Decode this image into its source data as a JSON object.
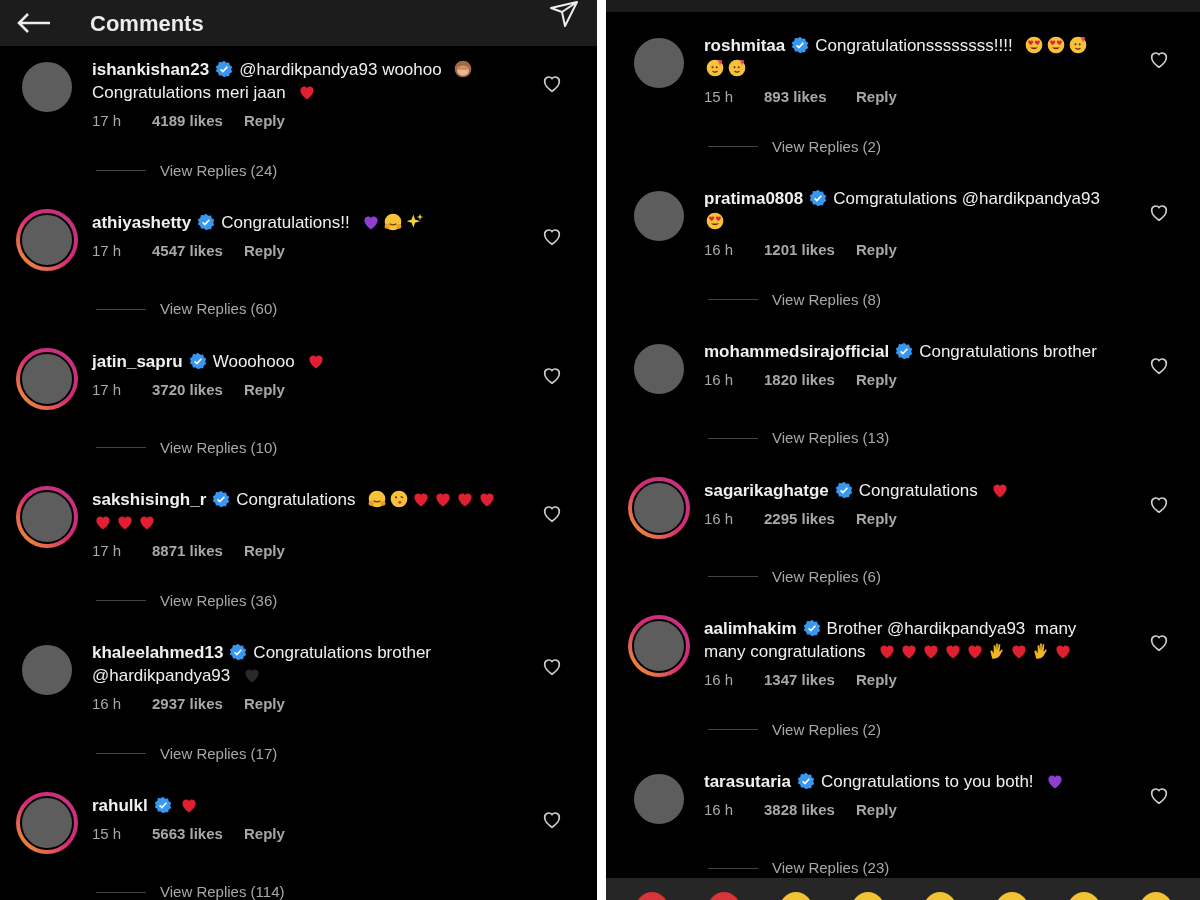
{
  "panels": [
    {
      "header": {
        "title": "Comments"
      },
      "comments": [
        {
          "user": "ishankishan23",
          "verified": true,
          "story_ring": false,
          "body": [
            {
              "kind": "text",
              "text": "@hardikpandya93 woohoo"
            },
            {
              "kind": "monkey"
            },
            {
              "kind": "text",
              "text": "Congratulations meri jaan"
            },
            {
              "kind": "heart",
              "color": "#e02030"
            }
          ],
          "time": "17 h",
          "likes": "4189 likes",
          "reply": "Reply",
          "view_replies": "View Replies (24)"
        },
        {
          "user": "athiyashetty",
          "verified": true,
          "story_ring": true,
          "body": [
            {
              "kind": "text",
              "text": "Congratulations!!"
            },
            {
              "kind": "heart",
              "color": "#8e3fd0"
            },
            {
              "kind": "hug"
            },
            {
              "kind": "sparkles"
            }
          ],
          "time": "17 h",
          "likes": "4547 likes",
          "reply": "Reply",
          "view_replies": "View Replies (60)"
        },
        {
          "user": "jatin_sapru",
          "verified": true,
          "story_ring": true,
          "body": [
            {
              "kind": "text",
              "text": "Wooohooo"
            },
            {
              "kind": "heart",
              "color": "#e02030"
            }
          ],
          "time": "17 h",
          "likes": "3720 likes",
          "reply": "Reply",
          "view_replies": "View Replies (10)"
        },
        {
          "user": "sakshisingh_r",
          "verified": true,
          "story_ring": true,
          "body": [
            {
              "kind": "text",
              "text": "Congratulations"
            },
            {
              "kind": "hug"
            },
            {
              "kind": "kiss"
            },
            {
              "kind": "heart",
              "color": "#e02030"
            },
            {
              "kind": "heart",
              "color": "#e02030"
            },
            {
              "kind": "heart",
              "color": "#e02030"
            },
            {
              "kind": "heart",
              "color": "#e02030"
            },
            {
              "kind": "heart",
              "color": "#e02030"
            },
            {
              "kind": "heart",
              "color": "#e02030"
            },
            {
              "kind": "heart",
              "color": "#e02030"
            }
          ],
          "time": "17 h",
          "likes": "8871 likes",
          "reply": "Reply",
          "view_replies": "View Replies (36)"
        },
        {
          "user": "khaleelahmed13",
          "verified": true,
          "story_ring": false,
          "body": [
            {
              "kind": "text",
              "text": "Congratulations brother"
            },
            {
              "kind": "text",
              "text": "@hardikpandya93"
            },
            {
              "kind": "heart",
              "color": "#2a2a2a"
            }
          ],
          "time": "16 h",
          "likes": "2937 likes",
          "reply": "Reply",
          "view_replies": "View Replies (17)"
        },
        {
          "user": "rahulkl",
          "verified": true,
          "story_ring": true,
          "body": [
            {
              "kind": "heart",
              "color": "#e02030"
            }
          ],
          "time": "15 h",
          "likes": "5663 likes",
          "reply": "Reply",
          "view_replies": "View Replies (114)"
        }
      ]
    },
    {
      "emoji_bar": true,
      "comments": [
        {
          "user": "roshmitaa",
          "verified": true,
          "story_ring": false,
          "body": [
            {
              "kind": "text",
              "text": "Congratulationssssssss!!!!"
            },
            {
              "kind": "heart-eyes"
            },
            {
              "kind": "heart-eyes"
            },
            {
              "kind": "party"
            },
            {
              "kind": "party"
            },
            {
              "kind": "party"
            }
          ],
          "time": "15 h",
          "likes": "893 likes",
          "reply": "Reply",
          "view_replies": "View Replies (2)"
        },
        {
          "user": "pratima0808",
          "verified": true,
          "story_ring": false,
          "body": [
            {
              "kind": "text",
              "text": "Comgratulations @hardikpandya93"
            },
            {
              "kind": "heart-eyes"
            }
          ],
          "time": "16 h",
          "likes": "1201 likes",
          "reply": "Reply",
          "view_replies": "View Replies (8)"
        },
        {
          "user": "mohammedsirajofficial",
          "verified": true,
          "story_ring": false,
          "body": [
            {
              "kind": "text",
              "text": "Congratulations brother"
            }
          ],
          "time": "16 h",
          "likes": "1820 likes",
          "reply": "Reply",
          "view_replies": "View Replies (13)"
        },
        {
          "user": "sagarikaghatge",
          "verified": true,
          "story_ring": true,
          "body": [
            {
              "kind": "text",
              "text": "Congratulations"
            },
            {
              "kind": "heart",
              "color": "#e02030"
            }
          ],
          "time": "16 h",
          "likes": "2295 likes",
          "reply": "Reply",
          "view_replies": "View Replies (6)"
        },
        {
          "user": "aalimhakim",
          "verified": true,
          "story_ring": true,
          "body": [
            {
              "kind": "text",
              "text": "Brother @hardikpandya93  many"
            },
            {
              "kind": "text",
              "text": "many congratulations"
            },
            {
              "kind": "heart",
              "color": "#e02030"
            },
            {
              "kind": "heart",
              "color": "#e02030"
            },
            {
              "kind": "heart",
              "color": "#e02030"
            },
            {
              "kind": "heart",
              "color": "#e02030"
            },
            {
              "kind": "heart",
              "color": "#e02030"
            },
            {
              "kind": "clap"
            },
            {
              "kind": "heart",
              "color": "#e02030"
            },
            {
              "kind": "clap"
            },
            {
              "kind": "heart",
              "color": "#e02030"
            }
          ],
          "time": "16 h",
          "likes": "1347 likes",
          "reply": "Reply",
          "view_replies": "View Replies (2)"
        },
        {
          "user": "tarasutaria",
          "verified": true,
          "story_ring": false,
          "body": [
            {
              "kind": "text",
              "text": "Congratulations to you both!"
            },
            {
              "kind": "heart",
              "color": "#8e3fd0"
            }
          ],
          "time": "16 h",
          "likes": "3828 likes",
          "reply": "Reply",
          "view_replies": "View Replies (23)"
        }
      ]
    }
  ]
}
